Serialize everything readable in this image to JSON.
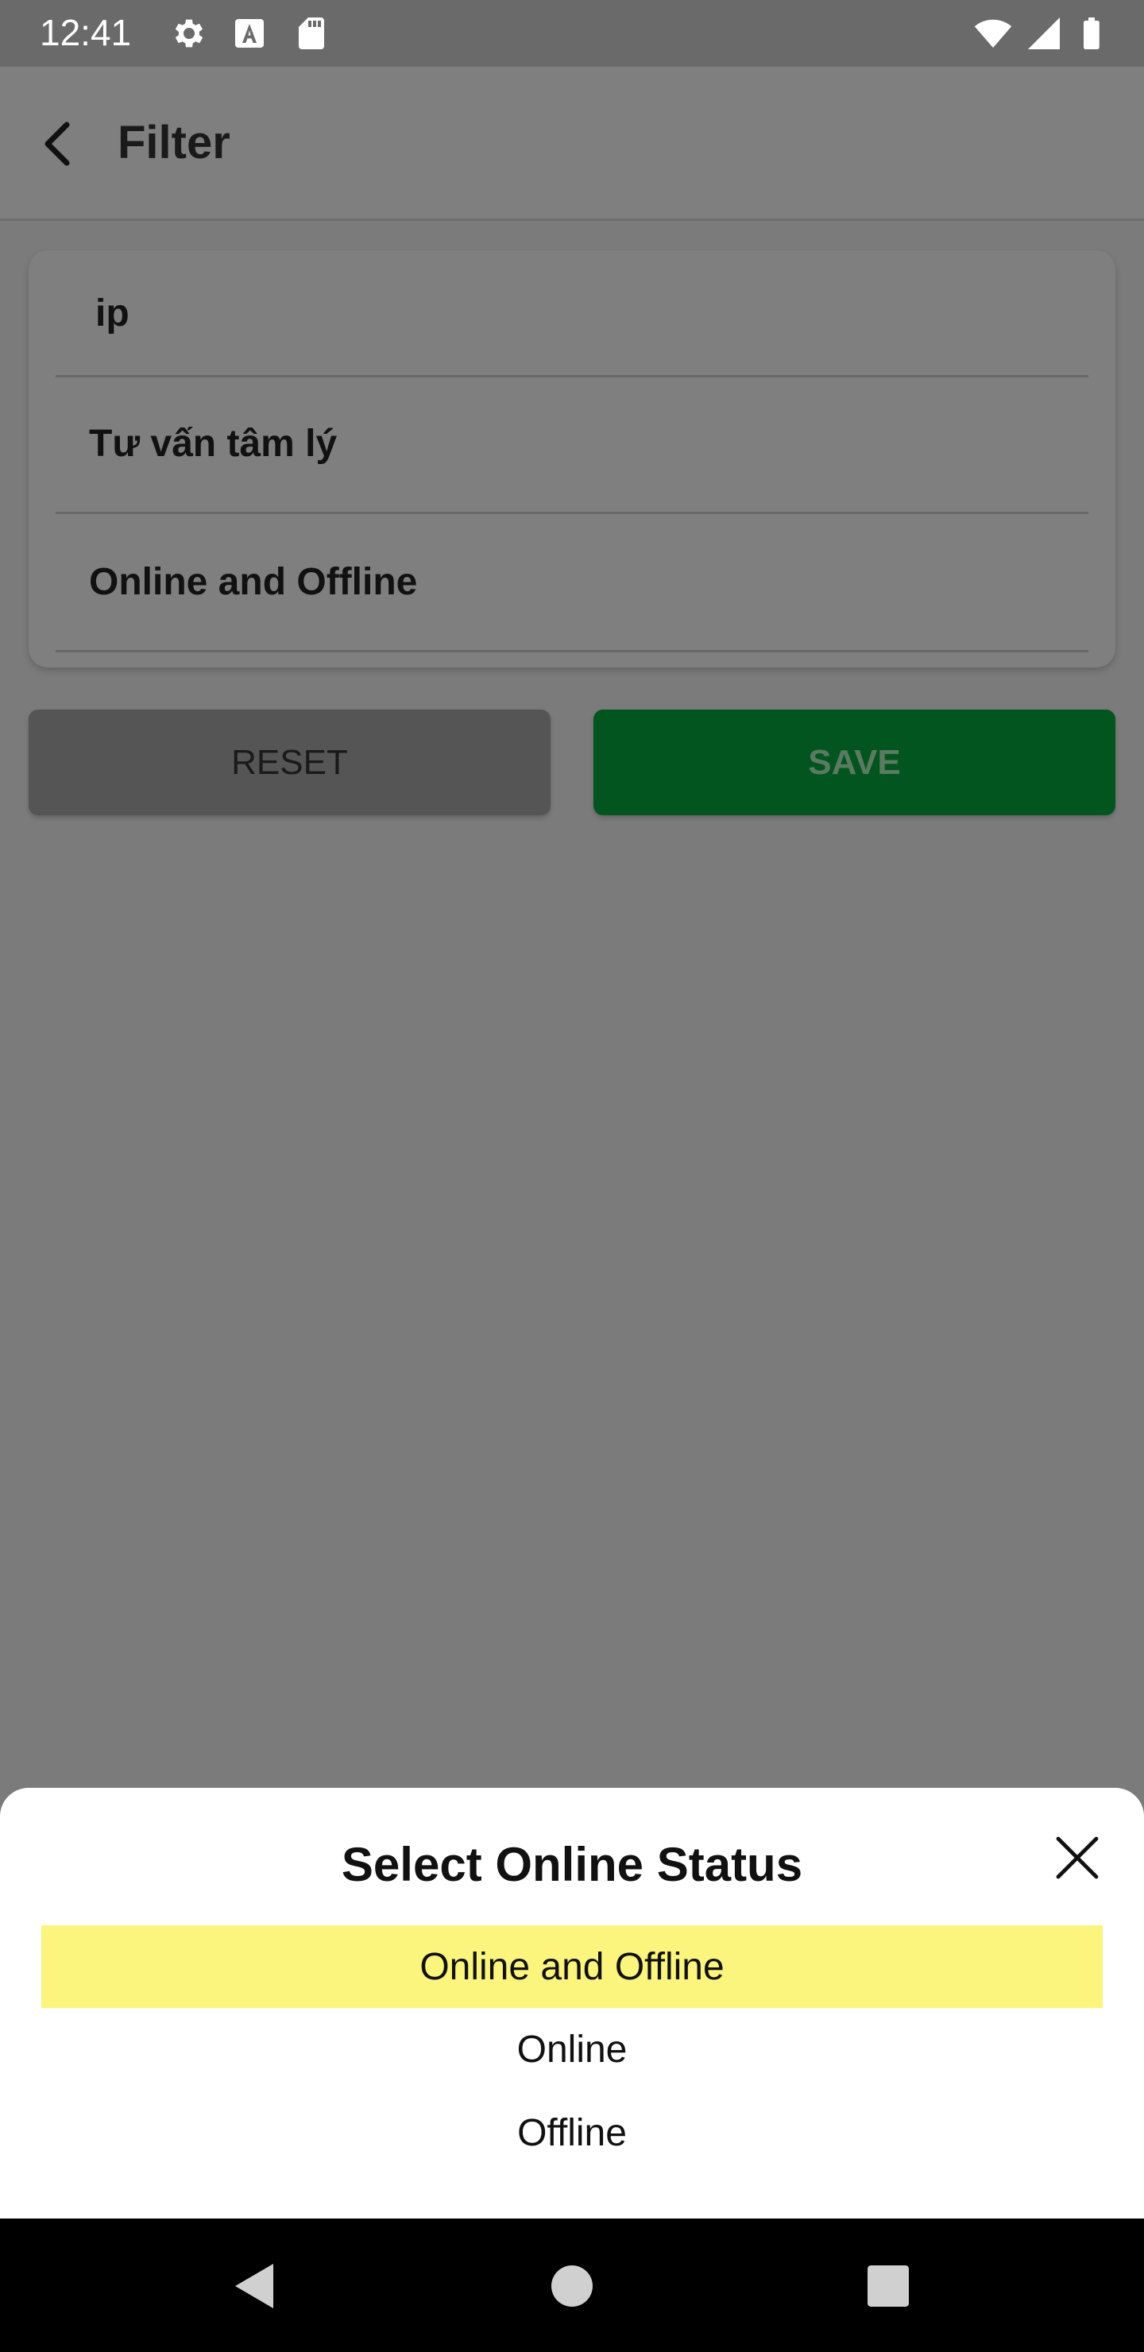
{
  "status_bar": {
    "time": "12:41",
    "left_icons": [
      "gear-icon",
      "a-letter-icon",
      "sd-card-icon"
    ],
    "right_icons": [
      "wifi-icon",
      "signal-icon",
      "battery-icon"
    ]
  },
  "app_bar": {
    "back_icon": "arrow-back-icon",
    "title": "Filter"
  },
  "filter_card": {
    "keyword_value": "ip",
    "category_value": "Tư vấn tâm lý",
    "status_value": "Online and Offline"
  },
  "actions": {
    "reset_label": "RESET",
    "save_label": "SAVE"
  },
  "bottom_sheet": {
    "title": "Select Online Status",
    "close_icon": "close-icon",
    "options": [
      {
        "label": "Online and Offline",
        "selected": true
      },
      {
        "label": "Online",
        "selected": false
      },
      {
        "label": "Offline",
        "selected": false
      }
    ]
  },
  "colors": {
    "save_button": "#035520",
    "selected_option": "#fbf47d",
    "reset_button": "#555555"
  },
  "nav_bar": {
    "icons": [
      "nav-back-icon",
      "nav-home-icon",
      "nav-recents-icon"
    ]
  }
}
